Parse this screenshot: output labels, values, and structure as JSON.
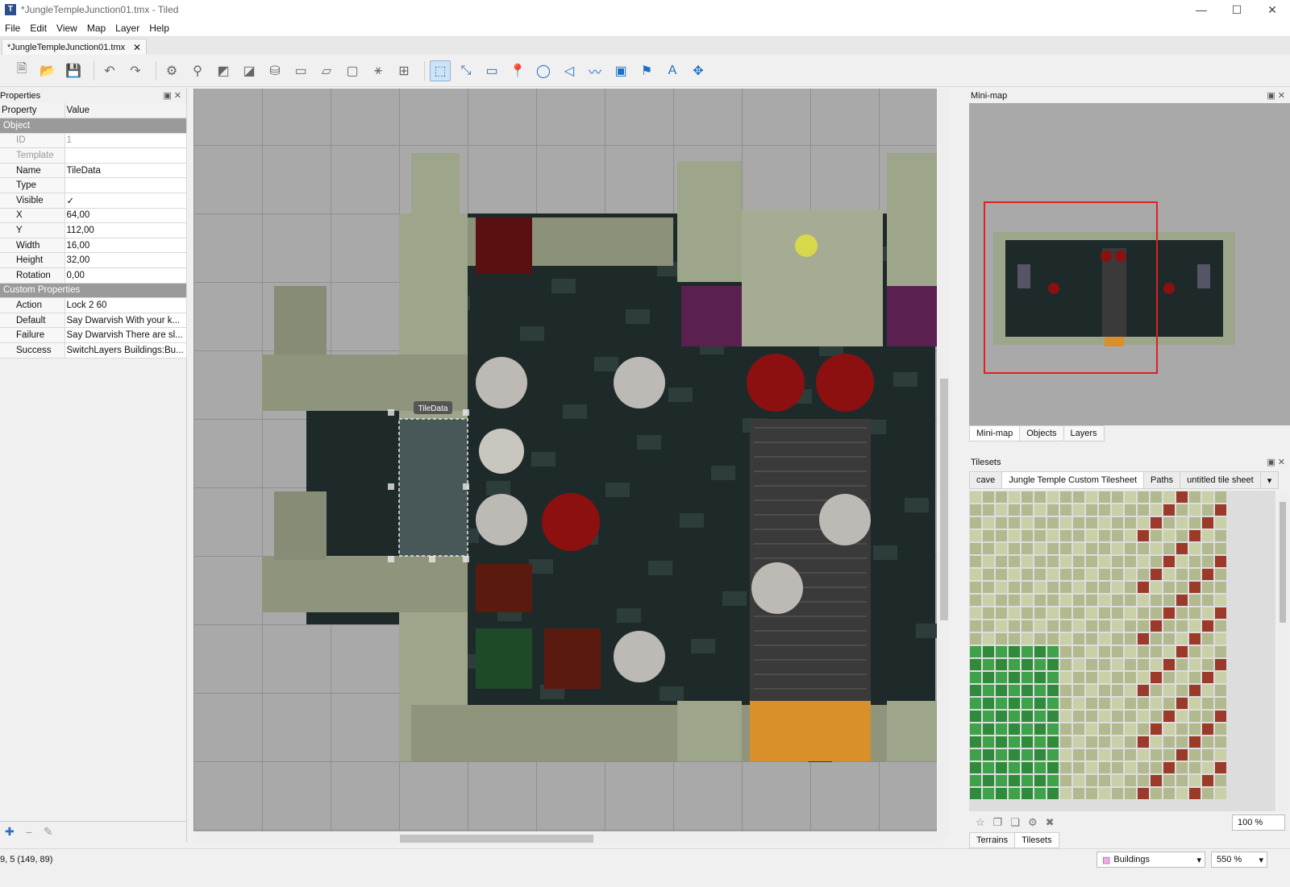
{
  "window": {
    "title": "*JungleTempleJunction01.tmx - Tiled",
    "app_icon": "T"
  },
  "menu": [
    "File",
    "Edit",
    "View",
    "Map",
    "Layer",
    "Help"
  ],
  "document_tab": {
    "label": "*JungleTempleJunction01.tmx",
    "close": "✕"
  },
  "toolbar": {
    "icons": [
      "new-map-icon",
      "open-file-icon",
      "save-icon",
      "undo-icon",
      "redo-icon",
      "command-icon",
      "stamp-brush-icon",
      "terrain-brush-icon",
      "wang-brush-icon",
      "bucket-fill-icon",
      "shape-fill-icon",
      "eraser-icon",
      "rectangular-select-icon",
      "magic-wand-icon",
      "select-same-tile-icon",
      "select-objects-icon",
      "edit-polygons-icon",
      "insert-rectangle-icon",
      "insert-point-icon",
      "insert-ellipse-icon",
      "insert-polygon-icon",
      "insert-polyline-icon",
      "insert-tile-icon",
      "insert-template-icon",
      "insert-text-icon",
      "move-icon"
    ]
  },
  "properties_panel": {
    "title": "Properties",
    "columns": [
      "Property",
      "Value"
    ],
    "object_section": "Object",
    "object_props": [
      {
        "name": "ID",
        "value": "1",
        "readonly": true
      },
      {
        "name": "Template",
        "value": "",
        "readonly": true
      },
      {
        "name": "Name",
        "value": "TileData"
      },
      {
        "name": "Type",
        "value": ""
      },
      {
        "name": "Visible",
        "value": "✓"
      },
      {
        "name": "X",
        "value": "64,00"
      },
      {
        "name": "Y",
        "value": "112,00"
      },
      {
        "name": "Width",
        "value": "16,00"
      },
      {
        "name": "Height",
        "value": "32,00"
      },
      {
        "name": "Rotation",
        "value": "0,00"
      }
    ],
    "custom_section": "Custom Properties",
    "custom_props": [
      {
        "name": "Action",
        "value": "Lock 2 60"
      },
      {
        "name": "Default",
        "value": "Say Dwarvish With your k..."
      },
      {
        "name": "Failure",
        "value": "Say Dwarvish There are sl..."
      },
      {
        "name": "Success",
        "value": "SwitchLayers Buildings:Bu..."
      }
    ]
  },
  "map_canvas": {
    "selected_object_label": "TileData"
  },
  "minimap_panel": {
    "title": "Mini-map",
    "tabs": [
      "Mini-map",
      "Objects",
      "Layers"
    ]
  },
  "tilesets_panel": {
    "title": "Tilesets",
    "sheet_tabs": [
      "cave",
      "Jungle Temple Custom Tilesheet",
      "Paths",
      "untitled tile sheet"
    ],
    "active_sheet": "Jungle Temple Custom Tilesheet",
    "zoom": "100 %",
    "bottom_tabs": [
      "Terrains",
      "Tilesets"
    ]
  },
  "status": {
    "coords": "9, 5 (149, 89)",
    "layer": "Buildings",
    "zoom": "550 %"
  },
  "colors": {
    "selection": "#e02020",
    "accent": "#2b6cc4",
    "floor": "#1e2a2a",
    "stone": "#9da58a",
    "red_orb": "#8c1010",
    "lava": "#d9902a"
  }
}
